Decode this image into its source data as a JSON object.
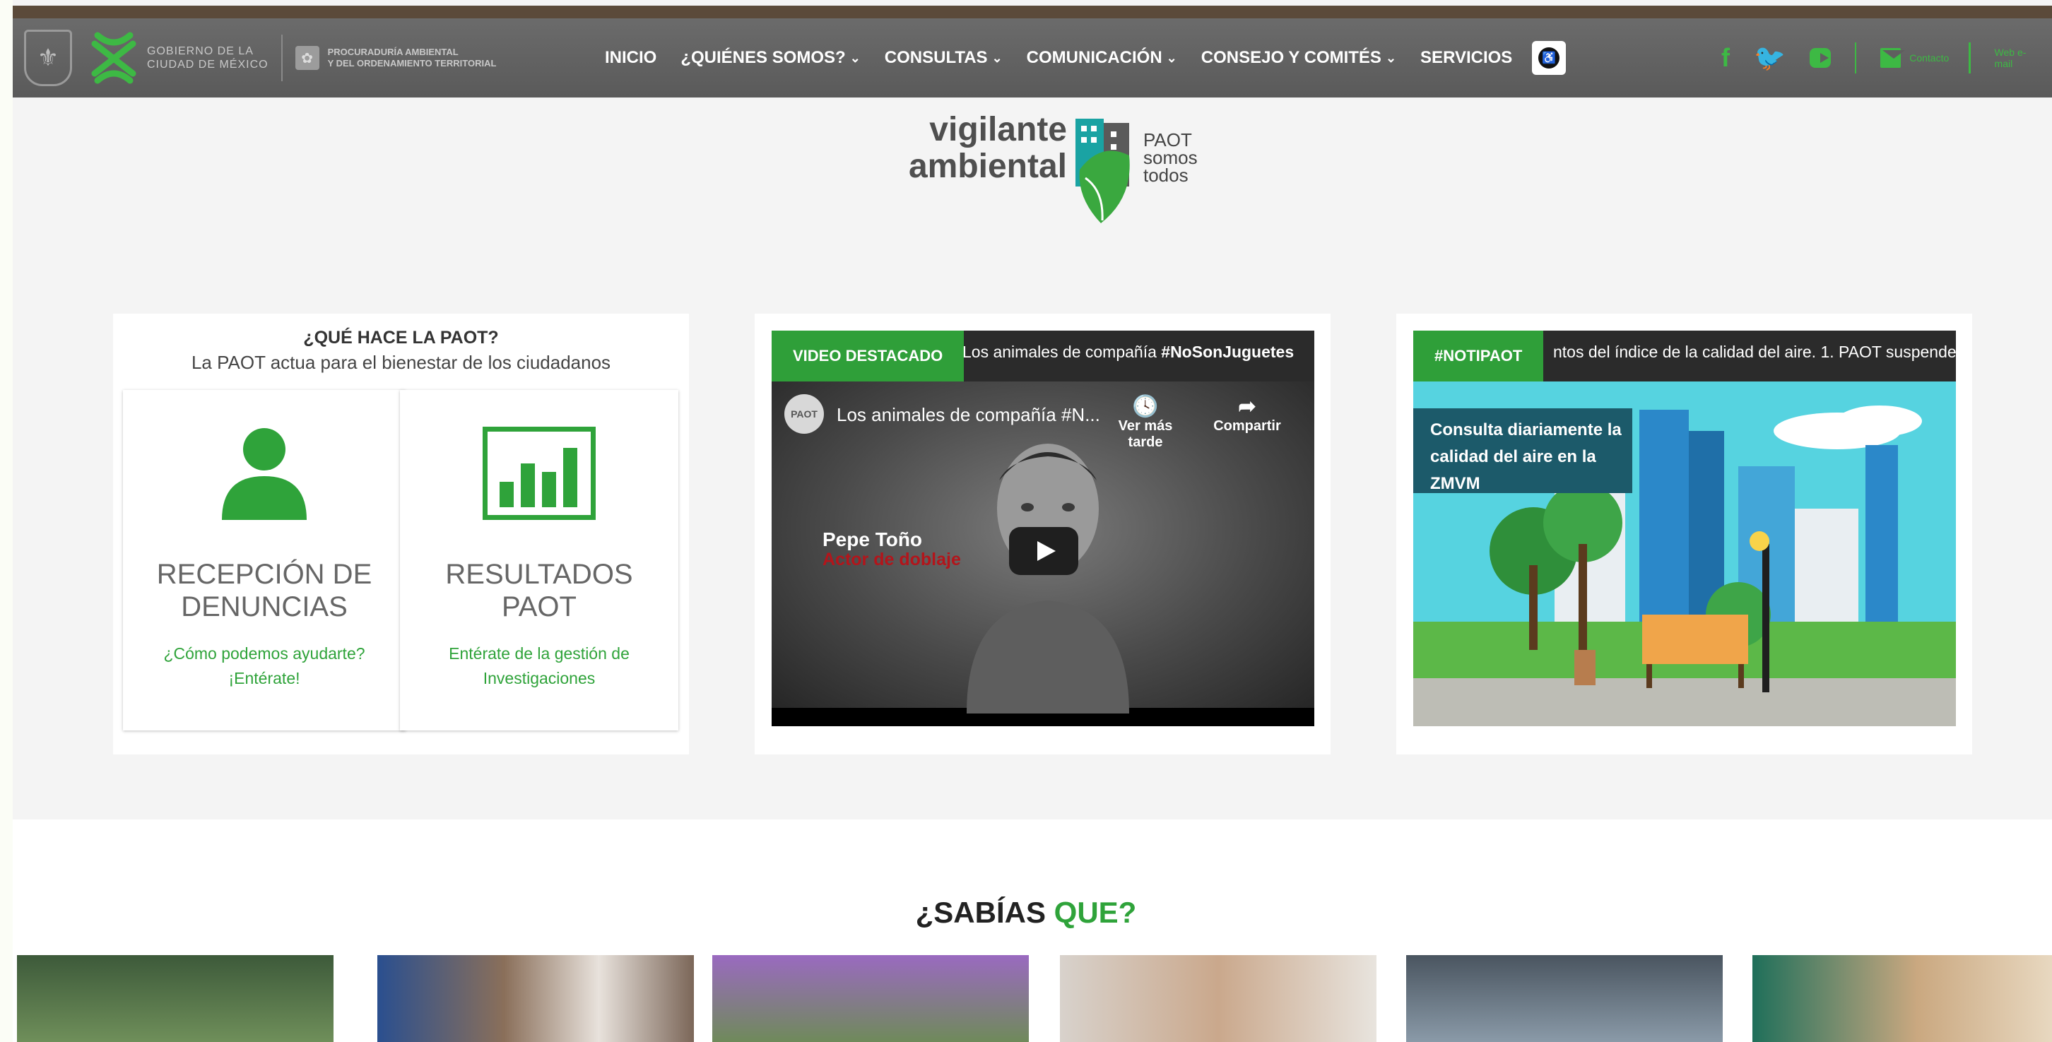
{
  "header": {
    "gov_text": [
      "GOBIERNO DE LA",
      "CIUDAD DE MÉXICO"
    ],
    "paot_text": [
      "PROCURADURÍA AMBIENTAL",
      "Y DEL ORDENAMIENTO TERRITORIAL"
    ],
    "nav": [
      {
        "label": "INICIO",
        "dropdown": false
      },
      {
        "label": "¿QUIÉNES SOMOS?",
        "dropdown": true
      },
      {
        "label": "CONSULTAS",
        "dropdown": true
      },
      {
        "label": "COMUNICACIÓN",
        "dropdown": true
      },
      {
        "label": "CONSEJO Y COMITÉS",
        "dropdown": true
      },
      {
        "label": "SERVICIOS",
        "dropdown": false
      }
    ],
    "social": {
      "contacto": "Contacto",
      "web_email": "Web e-mail"
    },
    "accent_color": "#3db944"
  },
  "logo": {
    "line1": "vigilante",
    "line2": "ambiental",
    "paot": "PAOT",
    "somos": "somos",
    "todos": "todos"
  },
  "que_hace": {
    "title": "¿QUÉ HACE LA PAOT?",
    "subtitle": "La PAOT actua para el bienestar de los ciudadanos",
    "tiles": [
      {
        "title": [
          "RECEPCIÓN DE",
          "DENUNCIAS"
        ],
        "link": [
          "¿Cómo podemos ayudarte?",
          "¡Entérate!"
        ],
        "icon": "user-icon"
      },
      {
        "title": [
          "RESULTADOS",
          "PAOT"
        ],
        "link": [
          "Entérate de la gestión de",
          "Investigaciones"
        ],
        "icon": "bar-chart-icon"
      }
    ]
  },
  "video": {
    "tag": "VIDEO DESTACADO",
    "banner_text": "Los animales de compañía",
    "banner_hashtag": "#NoSonJuguetes",
    "player_title": "Los animales de compañía #N...",
    "avatar_label": "PAOT",
    "watch_later": "Ver más tarde",
    "share": "Compartir",
    "caption_name": "Pepe Toño",
    "caption_role": "Actor de doblaje"
  },
  "notipaot": {
    "tag": "#NOTIPAOT",
    "ticker": "ntos del índice de la calidad del aire. 1. PAOT suspende",
    "image_text": [
      "Consulta diariamente la",
      "calidad del aire en la ZMVM"
    ]
  },
  "sabias": {
    "title_part1": "¿SABÍAS",
    "title_part2": "QUE?"
  }
}
